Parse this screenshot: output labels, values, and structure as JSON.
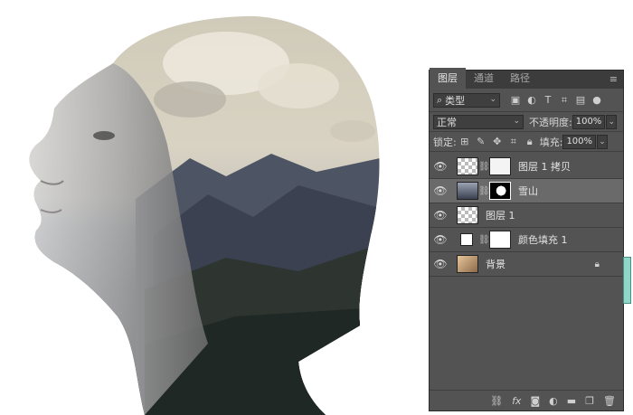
{
  "panel": {
    "tabs": [
      {
        "label": "图层"
      },
      {
        "label": "通道"
      },
      {
        "label": "路径"
      }
    ],
    "filter": {
      "value": "类型"
    },
    "blend_mode": "正常",
    "opacity_label": "不透明度:",
    "opacity_value": "100%",
    "lock_label": "锁定:",
    "fill_label": "填充:",
    "fill_value": "100%",
    "layers": [
      {
        "name": "图层 1 拷贝"
      },
      {
        "name": "雪山"
      },
      {
        "name": "图层 1"
      },
      {
        "name": "颜色填充 1"
      },
      {
        "name": "背景"
      }
    ]
  }
}
